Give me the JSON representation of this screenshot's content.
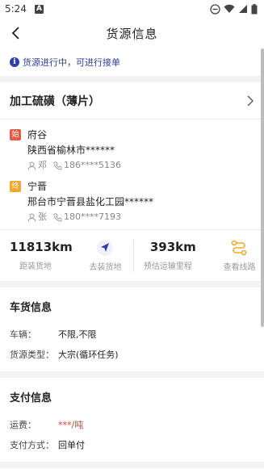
{
  "status_bar": {
    "time": "5:24",
    "notif_letter": "A"
  },
  "header": {
    "title": "货源信息"
  },
  "notice": {
    "icon_char": "i",
    "text": "货源进行中，可进行接单"
  },
  "cargo": {
    "name": "加工硫磺（薄片）"
  },
  "loading": {
    "tag": "始",
    "city": "府谷",
    "address": "陕西省榆林市******",
    "contact_name": "邓",
    "phone": "186****5136"
  },
  "unloading": {
    "tag": "终",
    "city": "宁晋",
    "address": "邢台市宁晋县盐化工园******",
    "contact_name": "张",
    "phone": "180****7193"
  },
  "stats": {
    "distance_to_load": "11813km",
    "distance_to_load_label": "距装货地",
    "go_load_label": "去装货地",
    "transport_distance": "393km",
    "transport_distance_label": "预估运输里程",
    "view_route_label": "查看线路"
  },
  "vehicle_section": {
    "title": "车货信息",
    "rows": [
      {
        "key": "车辆：",
        "value": "不限,不限"
      },
      {
        "key": "货源类型：",
        "value": "大宗(循环任务)"
      }
    ]
  },
  "payment_section": {
    "title": "支付信息",
    "rows": [
      {
        "key": "运费：",
        "value": "***/吨"
      },
      {
        "key": "支付方式：",
        "value": "回单付"
      }
    ]
  },
  "colors": {
    "accent": "#2d3fa8",
    "load_tag": "#e35b43",
    "unload_tag": "#f3a72c",
    "route": "#f3a72c",
    "price": "#e0402e"
  }
}
